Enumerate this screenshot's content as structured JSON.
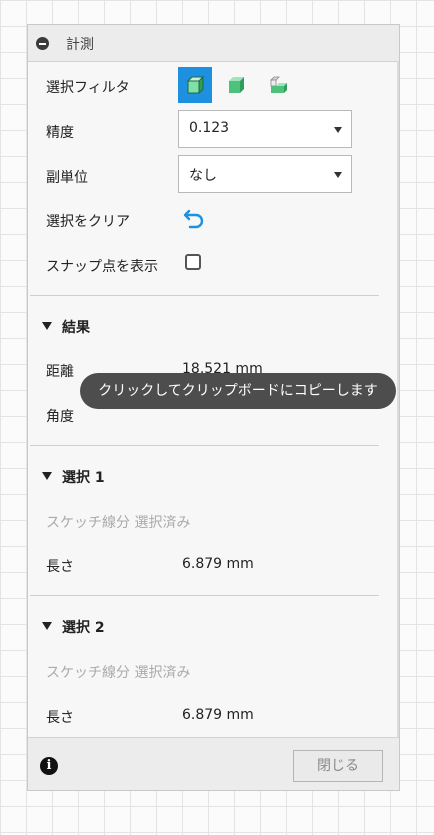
{
  "panel": {
    "title": "計測",
    "selection_filter": {
      "label": "選択フィルタ",
      "options": [
        {
          "icon": "body-cube-icon",
          "active": true
        },
        {
          "icon": "face-cube-icon",
          "active": false
        },
        {
          "icon": "edge-cube-icon",
          "active": false
        }
      ]
    },
    "precision": {
      "label": "精度",
      "value": "0.123"
    },
    "secondary_unit": {
      "label": "副単位",
      "value": "なし"
    },
    "clear_selection": {
      "label": "選択をクリア",
      "icon": "undo-icon"
    },
    "show_snap_points": {
      "label": "スナップ点を表示",
      "checked": false
    }
  },
  "results": {
    "header": "結果",
    "distance": {
      "label": "距離",
      "value": "18.521 mm"
    },
    "angle": {
      "label": "角度"
    },
    "tooltip": "クリックしてクリップボードにコピーします"
  },
  "selection1": {
    "header": "選択 1",
    "status": "スケッチ線分 選択済み",
    "length": {
      "label": "長さ",
      "value": "6.879 mm"
    }
  },
  "selection2": {
    "header": "選択 2",
    "status": "スケッチ線分 選択済み",
    "length": {
      "label": "長さ",
      "value": "6.879 mm"
    }
  },
  "footer": {
    "info_icon": "info-icon",
    "close_label": "閉じる"
  },
  "colors": {
    "accent": "#1e90e0",
    "cube_green": "#4cc27a",
    "tooltip_bg": "#4d4d4d"
  }
}
